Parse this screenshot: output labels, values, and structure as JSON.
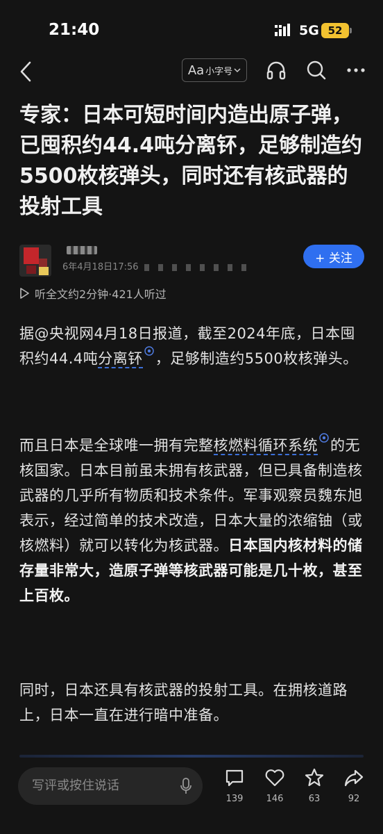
{
  "status": {
    "time": "21:40",
    "network": "5G",
    "battery": "52"
  },
  "nav": {
    "font_size_aa": "Aa",
    "font_size_label": "小字号"
  },
  "article": {
    "title": "专家：日本可短时间内造出原子弹，已囤积约44.4吨分离钚，足够制造约5500枚核弹头，同时还有核武器的投射工具",
    "meta_date": "6年4月18日17:56",
    "follow_label": "+ 关注",
    "listen_label": "听全文约2分钟·421人听过",
    "p1_a": "据@央视网4月18日报道，截至2024年底，日本囤积约44.4吨",
    "p1_term": "分离钚",
    "p1_b": "，足够制造约5500枚核弹头。",
    "p2_a": "而且日本是全球唯一拥有完整",
    "p2_term": "核燃料循环系统",
    "p2_b": "的无核国家。日本目前虽未拥有核武器，但已具备制造核武器的几乎所有物质和技术条件。军事观察员魏东旭表示，经过简单的技术改造，日本大量的浓缩铀（或核燃料）就可以转化为核武器。",
    "p2_bold": "日本国内核材料的储存量非常大，造原子弹等核武器可能是几十枚，甚至上百枚。",
    "p3": "同时，日本还具有核武器的投射工具。在拥核道路上，日本一直在进行暗中准备。"
  },
  "bottom": {
    "comment_placeholder": "写评或按住说话",
    "comment_count": "139",
    "like_count": "146",
    "star_count": "63",
    "share_count": "92"
  }
}
